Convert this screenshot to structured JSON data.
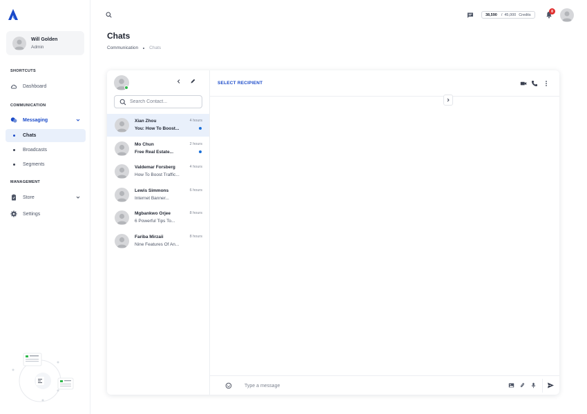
{
  "sidebar": {
    "user": {
      "name": "Will Golden",
      "role": "Admin"
    },
    "sections": {
      "shortcuts": "SHORTCUTS",
      "communication": "COMMUNICATION",
      "management": "MANAGEMENT"
    },
    "items": {
      "dashboard": "Dashboard",
      "messaging": "Messaging",
      "chats": "Chats",
      "broadcasts": "Broadcasts",
      "segments": "Segments",
      "store": "Store",
      "settings": "Settings"
    }
  },
  "topbar": {
    "credits_used": "38,590",
    "credits_separator": "/",
    "credits_total": "45,000",
    "credits_label": "Credits",
    "notification_count": "8"
  },
  "page": {
    "title": "Chats",
    "breadcrumb": [
      "Communication",
      "Chats"
    ]
  },
  "chat_list": {
    "search_placeholder": "Search Contact...",
    "conversations": [
      {
        "name": "Xian Zhou",
        "preview": "You: How To Boost...",
        "time": "4 hours",
        "unread": true,
        "selected": true
      },
      {
        "name": "Mo Chun",
        "preview": "Free Real Estate...",
        "time": "2 hours",
        "unread": true,
        "selected": false
      },
      {
        "name": "Valdemar Forsberg",
        "preview": "How To Boost Traffic...",
        "time": "4 hours",
        "unread": false,
        "selected": false
      },
      {
        "name": "Lewis Simmons",
        "preview": "Internet Banner...",
        "time": "6 hours",
        "unread": false,
        "selected": false
      },
      {
        "name": "Mgbankwo Orjee",
        "preview": "6 Powerful Tips To...",
        "time": "8 hours",
        "unread": false,
        "selected": false
      },
      {
        "name": "Fariba Mirzaii",
        "preview": "Nine Features Of An...",
        "time": "8 hours",
        "unread": false,
        "selected": false
      }
    ]
  },
  "chat_window": {
    "header": "SELECT RECIPIENT",
    "composer_placeholder": "Type a message"
  },
  "colors": {
    "accent": "#1a4ac9",
    "unread_dot": "#1a6fd8",
    "online": "#2eb84a",
    "badge": "#e02d2d",
    "selected_row": "#e9f0fb"
  }
}
